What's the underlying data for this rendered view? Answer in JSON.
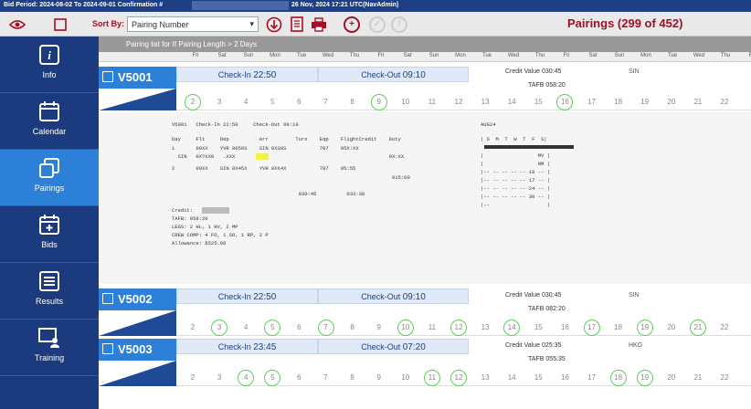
{
  "header": {
    "bid_period": "Bid Period: 2024-08-02 To 2024-09-01 Confirmation #",
    "datetime": "26 Nov, 2024 17:21 UTC(NavAdmin)"
  },
  "toolbar": {
    "sort_label": "Sort By:",
    "sort_value": "Pairing Number",
    "page_title": "Pairings (299 of 452)",
    "accent_color": "#a50f24"
  },
  "sidebar": {
    "items": [
      {
        "label": "Info",
        "icon": "info-icon"
      },
      {
        "label": "Calendar",
        "icon": "calendar-icon"
      },
      {
        "label": "Pairings",
        "icon": "pairings-icon",
        "active": true
      },
      {
        "label": "Bids",
        "icon": "bids-icon"
      },
      {
        "label": "Results",
        "icon": "results-icon"
      },
      {
        "label": "Training",
        "icon": "training-icon"
      }
    ]
  },
  "main": {
    "subheader": "Pairing list for If Pairing Length > 2 Days",
    "day_headers": [
      "Fri",
      "Sat",
      "Sun",
      "Mon",
      "Tue",
      "Wed",
      "Thu",
      "Fri",
      "Sat",
      "Sun",
      "Mon",
      "Tue",
      "Wed",
      "Thu",
      "Fri",
      "Sat",
      "Sun",
      "Mon",
      "Tue",
      "Wed",
      "Thu",
      "Fri"
    ]
  },
  "pairings": [
    {
      "id": "V5001",
      "checkin_label": "Check-In",
      "checkin_time": "22:50",
      "checkout_label": "Check-Out",
      "checkout_time": "09:10",
      "credit_value": "Credit Value 030:45",
      "tafb": "TAFB 058:20",
      "city": "SIN",
      "dates": [
        "2",
        "3",
        "4",
        "5",
        "6",
        "7",
        "8",
        "9",
        "10",
        "11",
        "12",
        "13",
        "14",
        "15",
        "16",
        "17",
        "18",
        "19",
        "20",
        "21",
        "22"
      ],
      "marked": [
        "2",
        "9",
        "16"
      ]
    },
    {
      "id": "V5002",
      "checkin_label": "Check-In",
      "checkin_time": "22:50",
      "checkout_label": "Check-Out",
      "checkout_time": "09:10",
      "credit_value": "Credit Value 030:45",
      "tafb": "TAFB 082:20",
      "city": "SIN",
      "dates": [
        "2",
        "3",
        "4",
        "5",
        "6",
        "7",
        "8",
        "9",
        "10",
        "11",
        "12",
        "13",
        "14",
        "15",
        "16",
        "17",
        "18",
        "19",
        "20",
        "21",
        "22"
      ],
      "marked": [
        "3",
        "5",
        "7",
        "10",
        "12",
        "14",
        "17",
        "19",
        "21"
      ]
    },
    {
      "id": "V5003",
      "checkin_label": "Check-In",
      "checkin_time": "23:45",
      "checkout_label": "Check-Out",
      "checkout_time": "07:20",
      "credit_value": "Credit Value 025:35",
      "tafb": "TAFB 055:35",
      "city": "HKG",
      "dates": [
        "2",
        "3",
        "4",
        "5",
        "6",
        "7",
        "8",
        "9",
        "10",
        "11",
        "12",
        "13",
        "14",
        "15",
        "16",
        "17",
        "18",
        "19",
        "20",
        "21",
        "22"
      ],
      "marked": [
        "4",
        "5",
        "11",
        "12",
        "18",
        "19"
      ]
    }
  ],
  "detail": {
    "header_line": "V5001   Check-In 22:50     Check-Out 09:10",
    "col_headers": "Day     Flt     Dep          Arr         Turn    Eqp    FlightCredit    Duty",
    "rows": [
      "1       00XX    YVR 0050S    SIN 0X30S           787    05X:XX",
      "  SIN   0X?XX0   .XXX                                                   0X:XX",
      "2       00XX    SIN 0X45X    YVR 0XX4X           787    05:55",
      "                                                                         015:00"
    ],
    "totals": "                                          030:45          033:30",
    "credit_label": "Credit:",
    "lines": [
      "TAFB: 058:20",
      "LEGS: 2 HL, 1 HV, 2 MP",
      "CREW COMP: 4 FO, 1 SO, 1 RP, 2 P",
      "Allowance: $525.60"
    ],
    "calendar_month": "AUG24",
    "calendar_dow": "| S  M  T  W  T  F  S|",
    "calendar_rows": [
      "|                  MV |",
      "|                  NM |",
      "|-- -- -- -- -- 10 -- |",
      "|-- -- -- -- -- 17 -- |",
      "|-- -- -- -- -- 24 -- |",
      "|-- -- -- -- -- 30 -- |",
      "|--                   |"
    ]
  }
}
